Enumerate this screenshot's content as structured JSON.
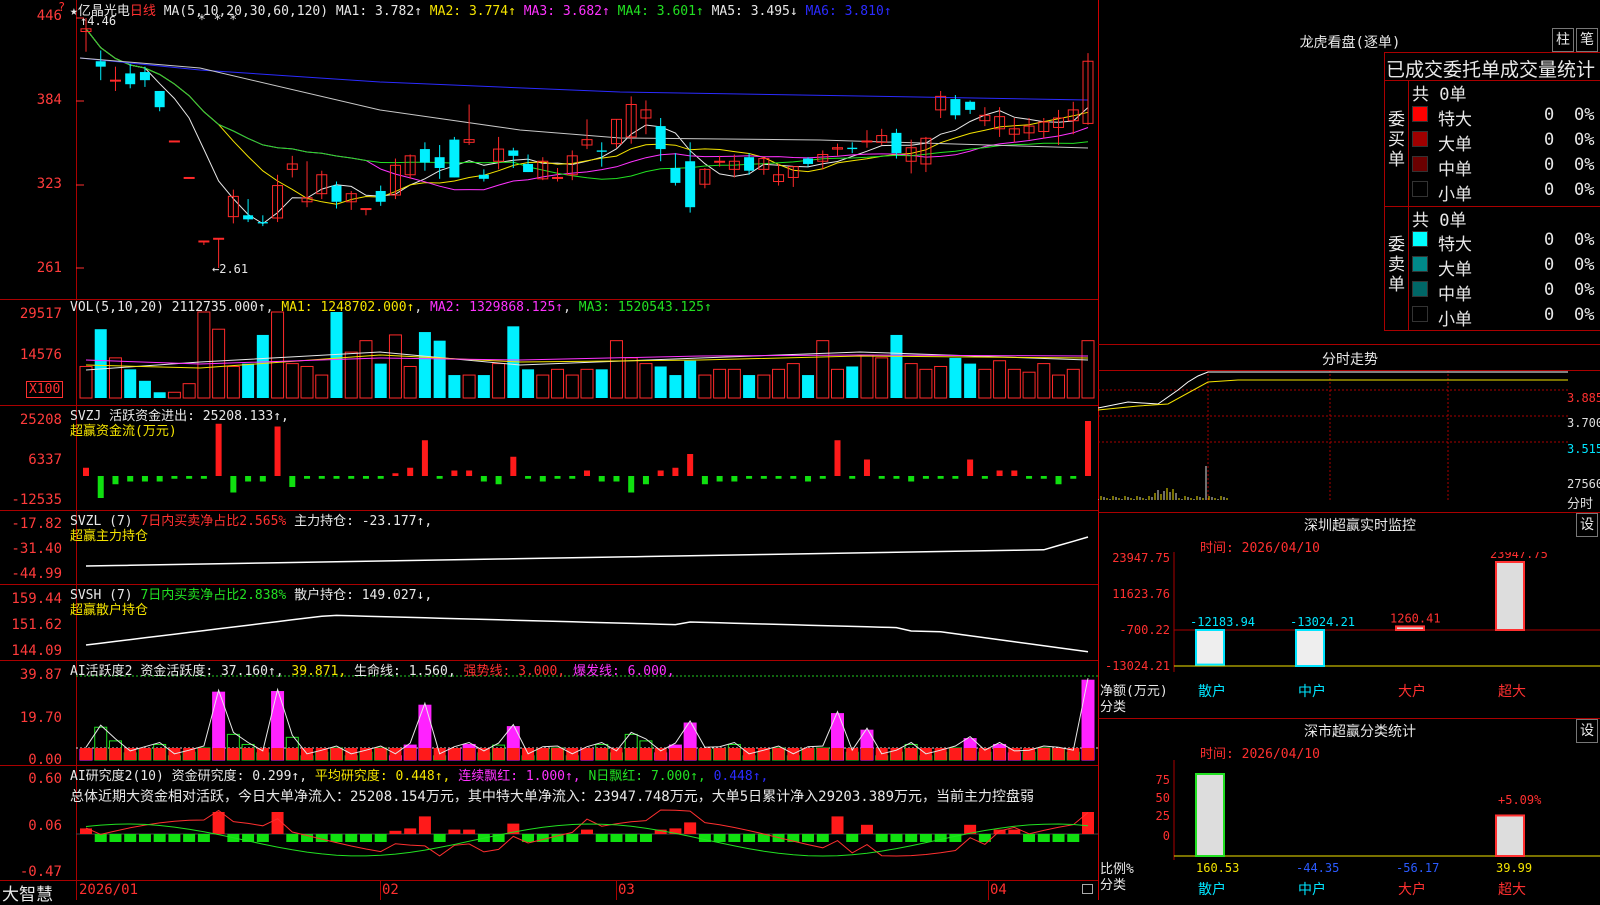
{
  "stock": {
    "name": "亿晶光电",
    "period": "日线",
    "star": "★",
    "marks": "* * *"
  },
  "price_panel": {
    "ma_label": "MA(5,10,20,30,60,120)",
    "ma_values": [
      {
        "text": "MA1: 3.782↑",
        "color": "#e8e8e8"
      },
      {
        "text": "MA2: 3.774↑",
        "color": "#f4e300"
      },
      {
        "text": "MA3: 3.682↑",
        "color": "#ff33ff"
      },
      {
        "text": "MA4: 3.601↑",
        "color": "#22e022"
      },
      {
        "text": "MA5: 3.495↓",
        "color": "#e8e8e8"
      },
      {
        "text": "MA6: 3.810↑",
        "color": "#2b2bff"
      }
    ],
    "yticks": [
      "446",
      "384",
      "323",
      "261"
    ],
    "high_mark": "4.46",
    "low_mark": "←2.61"
  },
  "vol_panel": {
    "label": "VOL(5,10,20)",
    "value": "2112735.000↑",
    "ma1": "MA1: 1248702.000↑",
    "ma2": "MA2: 1329868.125↑",
    "ma3": "MA3: 1520543.125↑",
    "yticks": [
      "29517",
      "14576"
    ],
    "unit": "X100"
  },
  "svzj_panel": {
    "label": "SVZJ",
    "text": "活跃资金进出: 25208.133↑,",
    "sub": "超赢资金流(万元)",
    "yticks": [
      "25208",
      "6337",
      "-12535"
    ]
  },
  "svzl_panel": {
    "label": "SVZL (7)",
    "text1": "7日内买卖净占比2.565%",
    "text2": "主力持仓: -23.177↑,",
    "sub": "超赢主力持仓",
    "yticks": [
      "-17.82",
      "-31.40",
      "-44.99"
    ]
  },
  "svsh_panel": {
    "label": "SVSH (7)",
    "text1": "7日内买卖净占比2.838%",
    "text2": "散户持仓: 149.027↓,",
    "sub": "超赢散户持仓",
    "yticks": [
      "159.44",
      "151.62",
      "144.09"
    ]
  },
  "ai_active_panel": {
    "label": "AI活跃度2",
    "t1": "资金活跃度: 37.160↑,",
    "t2": "39.871,",
    "t3": "生命线: 1.560,",
    "t4": "强势线: 3.000,",
    "t5": "爆发线: 6.000,",
    "yticks": [
      "39.87",
      "19.70",
      "0.00"
    ]
  },
  "ai_research_panel": {
    "label": "AI研究度2(10)",
    "t1": "资金研究度: 0.299↑,",
    "t2": "平均研究度: 0.448↑,",
    "t3": "连续飘红: 1.000↑,",
    "t4": "N日飘红: 7.000↑,",
    "t5": "0.448↑,",
    "summary": "总体近期大资金相对活跃，今日大单净流入：25208.154万元，其中特大单净流入：23947.748万元，大单5日累计净入29203.389万元，当前主力控盘弱",
    "yticks": [
      "0.60",
      "0.06",
      "-0.47"
    ]
  },
  "x_axis": {
    "labels": [
      "2026/01",
      "02",
      "03",
      "04"
    ],
    "brand": "大智慧"
  },
  "order_book": {
    "title": "龙虎看盘(逐单)",
    "tab1": "柱",
    "tab2": "笔",
    "header": "已成交委托单成交量统计",
    "buy": {
      "side": "委买单",
      "total": "共 0单",
      "rows": [
        {
          "name": "特大",
          "v": "0",
          "p": "0%",
          "color": "#ff0000"
        },
        {
          "name": "大单",
          "v": "0",
          "p": "0%",
          "color": "#a00000"
        },
        {
          "name": "中单",
          "v": "0",
          "p": "0%",
          "color": "#6a0000"
        },
        {
          "name": "小单",
          "v": "0",
          "p": "0%",
          "color": "#000000"
        }
      ]
    },
    "sell": {
      "side": "委卖单",
      "total": "共 0单",
      "rows": [
        {
          "name": "特大",
          "v": "0",
          "p": "0%",
          "color": "#00ffff"
        },
        {
          "name": "大单",
          "v": "0",
          "p": "0%",
          "color": "#008888"
        },
        {
          "name": "中单",
          "v": "0",
          "p": "0%",
          "color": "#006666"
        },
        {
          "name": "小单",
          "v": "0",
          "p": "0%",
          "color": "#000000"
        }
      ]
    }
  },
  "intraday": {
    "title": "分时走势",
    "y1": "3.885",
    "y2": "3.700",
    "y3": "3.515",
    "vol": "27560",
    "vol_label": "分时"
  },
  "monitor": {
    "title": "深圳超赢实时监控",
    "btn": "设",
    "date": "时间: 2026/04/10",
    "yticks": [
      "23947.75",
      "11623.76",
      "-700.22",
      "-13024.21"
    ],
    "ylabel": "净额(万元)",
    "xlabel": "分类",
    "cats": [
      "散户",
      "中户",
      "大户",
      "超大"
    ],
    "vals": [
      "-12183.94",
      "-13024.21",
      "1260.41",
      "23947.75"
    ]
  },
  "classify": {
    "title": "深市超赢分类统计",
    "btn": "设",
    "date": "时间: 2026/04/10",
    "yticks": [
      "75",
      "50",
      "25",
      "0"
    ],
    "ylabel": "比例%",
    "xlabel": "分类",
    "cats": [
      "散户",
      "中户",
      "大户",
      "超大"
    ],
    "vals": [
      "160.53",
      "-44.35",
      "-56.17",
      "39.99"
    ],
    "pct": "+5.09%"
  },
  "chart_data": {
    "type": "candlestick",
    "dates_axis": [
      "2026/01",
      "02",
      "03",
      "04"
    ],
    "ohlc": [
      [
        436,
        446,
        421,
        438
      ],
      [
        414,
        422,
        400,
        410
      ],
      [
        400,
        410,
        392,
        400
      ],
      [
        405,
        412,
        394,
        397
      ],
      [
        406,
        410,
        395,
        400
      ],
      [
        392,
        392,
        377,
        380
      ],
      [
        355,
        355,
        355,
        355
      ],
      [
        328,
        328,
        328,
        328
      ],
      [
        281,
        281,
        278,
        281
      ],
      [
        283,
        283,
        261,
        283
      ],
      [
        299,
        319,
        294,
        314
      ],
      [
        300,
        312,
        295,
        297
      ],
      [
        295,
        300,
        292,
        294
      ],
      [
        298,
        330,
        295,
        322
      ],
      [
        334,
        344,
        328,
        338
      ],
      [
        310,
        340,
        306,
        313
      ],
      [
        316,
        333,
        312,
        330
      ],
      [
        322,
        325,
        305,
        310
      ],
      [
        310,
        318,
        304,
        316
      ],
      [
        305,
        305,
        300,
        305
      ],
      [
        318,
        322,
        307,
        310
      ],
      [
        315,
        342,
        312,
        337
      ],
      [
        330,
        345,
        327,
        344
      ],
      [
        349,
        354,
        333,
        339
      ],
      [
        343,
        352,
        327,
        335
      ],
      [
        356,
        358,
        328,
        328
      ],
      [
        354,
        382,
        352,
        356
      ],
      [
        330,
        334,
        325,
        327
      ],
      [
        340,
        358,
        334,
        349
      ],
      [
        348,
        350,
        335,
        344
      ],
      [
        338,
        345,
        332,
        332
      ],
      [
        327,
        343,
        326,
        340
      ],
      [
        328,
        335,
        325,
        328
      ],
      [
        330,
        348,
        326,
        344
      ],
      [
        352,
        371,
        349,
        356
      ],
      [
        348,
        354,
        336,
        347
      ],
      [
        353,
        371,
        350,
        371
      ],
      [
        358,
        388,
        353,
        382
      ],
      [
        372,
        385,
        360,
        378
      ],
      [
        366,
        372,
        340,
        349
      ],
      [
        335,
        346,
        322,
        324
      ],
      [
        340,
        354,
        302,
        306
      ],
      [
        323,
        335,
        320,
        334
      ],
      [
        340,
        344,
        336,
        340
      ],
      [
        334,
        345,
        328,
        340
      ],
      [
        343,
        346,
        330,
        333
      ],
      [
        334,
        343,
        330,
        342
      ],
      [
        325,
        338,
        322,
        330
      ],
      [
        328,
        336,
        321,
        336
      ],
      [
        342,
        343,
        336,
        338
      ],
      [
        340,
        348,
        334,
        345
      ],
      [
        349,
        353,
        344,
        350
      ],
      [
        350,
        354,
        346,
        349
      ],
      [
        355,
        363,
        350,
        355
      ],
      [
        354,
        364,
        352,
        359
      ],
      [
        361,
        364,
        342,
        346
      ],
      [
        340,
        356,
        331,
        350
      ],
      [
        338,
        358,
        332,
        357
      ],
      [
        378,
        392,
        372,
        388
      ],
      [
        386,
        389,
        371,
        374
      ],
      [
        384,
        385,
        375,
        378
      ],
      [
        370,
        380,
        366,
        374
      ],
      [
        364,
        380,
        358,
        373
      ],
      [
        360,
        372,
        354,
        364
      ],
      [
        361,
        372,
        356,
        366
      ],
      [
        362,
        372,
        357,
        369
      ],
      [
        365,
        378,
        352,
        372
      ],
      [
        370,
        384,
        360,
        378
      ],
      [
        368,
        420,
        367,
        414
      ]
    ],
    "volume": [
      11,
      24,
      14,
      10,
      6,
      2,
      2,
      5,
      30,
      24,
      11,
      12,
      22,
      30,
      12,
      11,
      8,
      30,
      16,
      20,
      12,
      22,
      11,
      23,
      20,
      8,
      8,
      8,
      12,
      25,
      10,
      8,
      10,
      8,
      10,
      10,
      20,
      14,
      12,
      11,
      8,
      13,
      8,
      10,
      10,
      8,
      8,
      10,
      12,
      8,
      20,
      10,
      11,
      15,
      14,
      22,
      12,
      10,
      11,
      14,
      12,
      10,
      13,
      10,
      9,
      12,
      8,
      10,
      20
    ],
    "fund_flow": [
      3,
      -8,
      -3,
      -2,
      -2,
      -2,
      -1,
      -1,
      -1,
      19,
      -6,
      -2,
      -2,
      18,
      -4,
      -1,
      -1,
      -1,
      -1,
      -1,
      -1,
      1,
      3,
      13,
      -1,
      2,
      2,
      -2,
      -3,
      7,
      -1,
      -2,
      -1,
      -1,
      2,
      -2,
      -2,
      -6,
      -3,
      2,
      3,
      8,
      -3,
      -2,
      -2,
      -1,
      -1,
      -1,
      -1,
      -2,
      -1,
      13,
      -1,
      6,
      -1,
      -1,
      -2,
      -1,
      -1,
      -1,
      6,
      -1,
      2,
      2,
      -1,
      -1,
      -3,
      -1,
      20
    ],
    "ylim": [
      261,
      446
    ]
  }
}
